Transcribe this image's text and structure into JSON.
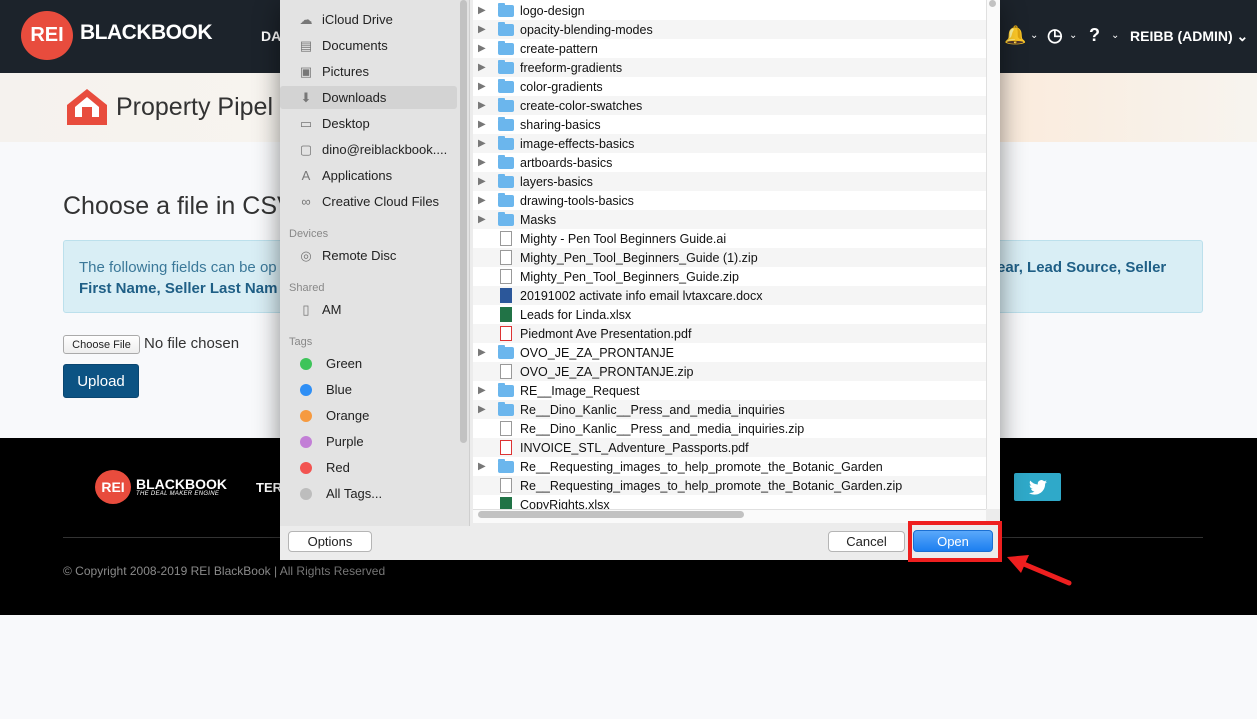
{
  "header": {
    "logo_mark": "REI",
    "logo_word": "BLACKBOOK",
    "nav_fragment": "DA",
    "user_menu": "REIBB (ADMIN)"
  },
  "hero": {
    "title": "Property Pipel"
  },
  "main": {
    "heading": "Choose a file in CSV",
    "info_line1_left": "The following fields can be op",
    "info_line1_right": "ear, Lead Source, Seller",
    "info_line2": "First Name, Seller Last Nam",
    "choose_file_label": "Choose File",
    "no_file_text": "No file chosen",
    "upload_label": "Upload"
  },
  "footer": {
    "logo_mark": "REI",
    "logo_word": "BLACKBOOK",
    "logo_tagline": "THE DEAL MAKER ENGINE",
    "nav_fragment": "TER",
    "copyright": "© Copyright 2008-2019 REI BlackBook | All Rights Reserved"
  },
  "dialog": {
    "sidebar": {
      "favorites": [
        {
          "label": "iCloud Drive",
          "icon": "cloud-icon"
        },
        {
          "label": "Documents",
          "icon": "documents-icon"
        },
        {
          "label": "Pictures",
          "icon": "camera-icon"
        },
        {
          "label": "Downloads",
          "icon": "download-icon"
        },
        {
          "label": "Desktop",
          "icon": "desktop-icon"
        },
        {
          "label": "dino@reiblackbook....",
          "icon": "folder-icon"
        },
        {
          "label": "Applications",
          "icon": "applications-icon"
        },
        {
          "label": "Creative Cloud Files",
          "icon": "creative-cloud-icon"
        }
      ],
      "devices_heading": "Devices",
      "devices": [
        {
          "label": "Remote Disc",
          "icon": "disc-icon"
        }
      ],
      "shared_heading": "Shared",
      "shared": [
        {
          "label": "AM",
          "icon": "computer-icon"
        }
      ],
      "tags_heading": "Tags",
      "tags": [
        {
          "label": "Green",
          "color": "#3ec45a"
        },
        {
          "label": "Blue",
          "color": "#2f8ff5"
        },
        {
          "label": "Orange",
          "color": "#f69a40"
        },
        {
          "label": "Purple",
          "color": "#c27fd6"
        },
        {
          "label": "Red",
          "color": "#f25451"
        },
        {
          "label": "All Tags...",
          "color": "#bdbdbd"
        }
      ]
    },
    "files": [
      {
        "name": "logo-design",
        "kind": "folder"
      },
      {
        "name": "opacity-blending-modes",
        "kind": "folder"
      },
      {
        "name": "create-pattern",
        "kind": "folder"
      },
      {
        "name": "freeform-gradients",
        "kind": "folder"
      },
      {
        "name": "color-gradients",
        "kind": "folder"
      },
      {
        "name": "create-color-swatches",
        "kind": "folder"
      },
      {
        "name": "sharing-basics",
        "kind": "folder"
      },
      {
        "name": "image-effects-basics",
        "kind": "folder"
      },
      {
        "name": "artboards-basics",
        "kind": "folder"
      },
      {
        "name": "layers-basics",
        "kind": "folder"
      },
      {
        "name": "drawing-tools-basics",
        "kind": "folder"
      },
      {
        "name": "Masks",
        "kind": "folder"
      },
      {
        "name": "Mighty - Pen Tool Beginners Guide.ai",
        "kind": "ai"
      },
      {
        "name": "Mighty_Pen_Tool_Beginners_Guide (1).zip",
        "kind": "zip"
      },
      {
        "name": "Mighty_Pen_Tool_Beginners_Guide.zip",
        "kind": "zip"
      },
      {
        "name": "20191002 activate info email lvtaxcare.docx",
        "kind": "word"
      },
      {
        "name": "Leads for Linda.xlsx",
        "kind": "excel"
      },
      {
        "name": "Piedmont Ave Presentation.pdf",
        "kind": "pdf"
      },
      {
        "name": "OVO_JE_ZA_PRONTANJE",
        "kind": "folder"
      },
      {
        "name": "OVO_JE_ZA_PRONTANJE.zip",
        "kind": "zip"
      },
      {
        "name": "RE__Image_Request",
        "kind": "folder"
      },
      {
        "name": "Re__Dino_Kanlic__Press_and_media_inquiries",
        "kind": "folder"
      },
      {
        "name": "Re__Dino_Kanlic__Press_and_media_inquiries.zip",
        "kind": "zip"
      },
      {
        "name": "INVOICE_STL_Adventure_Passports.pdf",
        "kind": "pdf"
      },
      {
        "name": "Re__Requesting_images_to_help_promote_the_Botanic_Garden",
        "kind": "folder"
      },
      {
        "name": "Re__Requesting_images_to_help_promote_the_Botanic_Garden.zip",
        "kind": "zip"
      },
      {
        "name": "CopyRights.xlsx",
        "kind": "excel"
      }
    ],
    "buttons": {
      "options": "Options",
      "cancel": "Cancel",
      "open": "Open"
    }
  }
}
